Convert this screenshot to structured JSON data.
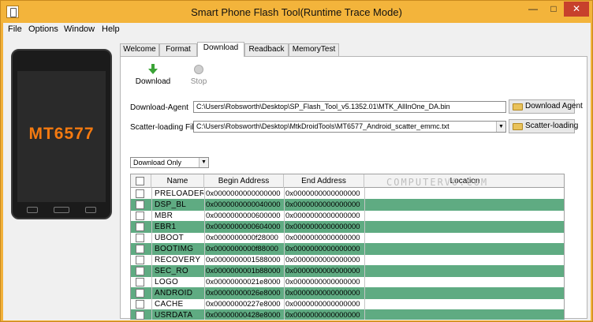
{
  "window": {
    "title": "Smart Phone Flash Tool(Runtime Trace Mode)",
    "accent_color": "#f3b43b"
  },
  "menu": [
    {
      "label": "File"
    },
    {
      "label": "Options"
    },
    {
      "label": "Window"
    },
    {
      "label": "Help"
    }
  ],
  "phone": {
    "label": "MT6577"
  },
  "tabs": [
    {
      "label": "Welcome"
    },
    {
      "label": "Format"
    },
    {
      "label": "Download",
      "active": true
    },
    {
      "label": "Readback"
    },
    {
      "label": "MemoryTest"
    }
  ],
  "toolbar": {
    "download_label": "Download",
    "stop_label": "Stop"
  },
  "download_agent": {
    "label": "Download-Agent",
    "path": "C:\\Users\\Robsworth\\Desktop\\SP_Flash_Tool_v5.1352.01\\MTK_AllInOne_DA.bin",
    "button_label": "Download Agent"
  },
  "scatter": {
    "label": "Scatter-loading File",
    "path": "C:\\Users\\Robsworth\\Desktop\\MtkDroidTools\\MT6577_Android_scatter_emmc.txt",
    "button_label": "Scatter-loading"
  },
  "mode": {
    "selected": "Download Only"
  },
  "table": {
    "headers": [
      "Name",
      "Begin Address",
      "End Address",
      "Location"
    ],
    "highlight_color": "#5fab82",
    "rows": [
      {
        "name": "PRELOADER",
        "begin": "0x0000000000000000",
        "end": "0x0000000000000000",
        "highlight": false
      },
      {
        "name": "DSP_BL",
        "begin": "0x0000000000040000",
        "end": "0x0000000000000000",
        "highlight": true
      },
      {
        "name": "MBR",
        "begin": "0x0000000000600000",
        "end": "0x0000000000000000",
        "highlight": false
      },
      {
        "name": "EBR1",
        "begin": "0x0000000000604000",
        "end": "0x0000000000000000",
        "highlight": true
      },
      {
        "name": "UBOOT",
        "begin": "0x0000000000f28000",
        "end": "0x0000000000000000",
        "highlight": false
      },
      {
        "name": "BOOTIMG",
        "begin": "0x0000000000f88000",
        "end": "0x0000000000000000",
        "highlight": true
      },
      {
        "name": "RECOVERY",
        "begin": "0x0000000001588000",
        "end": "0x0000000000000000",
        "highlight": false
      },
      {
        "name": "SEC_RO",
        "begin": "0x0000000001b88000",
        "end": "0x0000000000000000",
        "highlight": true
      },
      {
        "name": "LOGO",
        "begin": "0x00000000021e8000",
        "end": "0x0000000000000000",
        "highlight": false
      },
      {
        "name": "ANDROID",
        "begin": "0x00000000026e8000",
        "end": "0x0000000000000000",
        "highlight": true
      },
      {
        "name": "CACHE",
        "begin": "0x00000000227e8000",
        "end": "0x0000000000000000",
        "highlight": false
      },
      {
        "name": "USRDATA",
        "begin": "0x00000000428e8000",
        "end": "0x0000000000000000",
        "highlight": true
      }
    ]
  },
  "watermark": "COMPUTERVO.COM"
}
